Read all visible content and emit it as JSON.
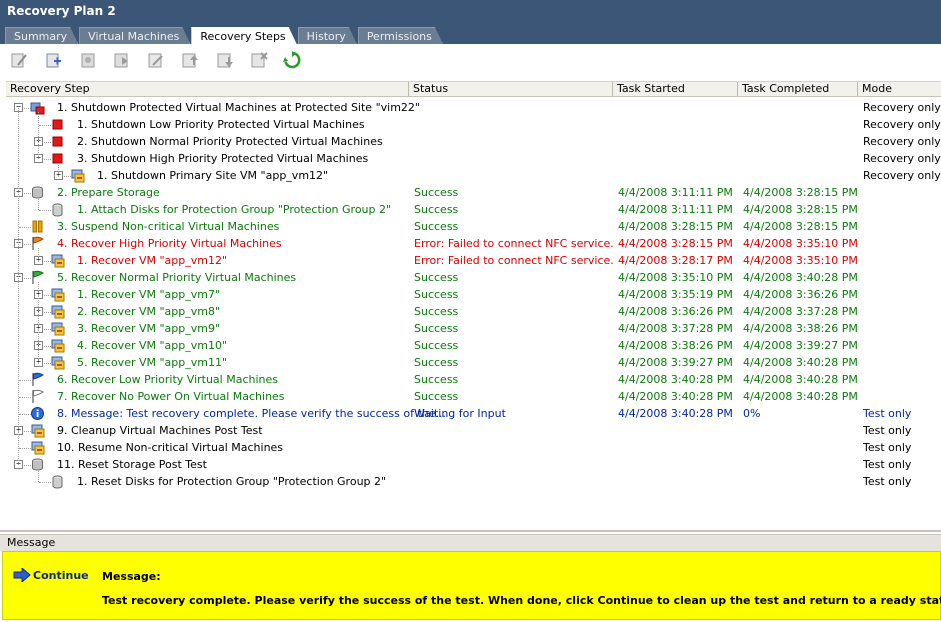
{
  "window": {
    "title": "Recovery Plan 2"
  },
  "tabs": [
    {
      "label": "Summary",
      "active": false
    },
    {
      "label": "Virtual Machines",
      "active": false
    },
    {
      "label": "Recovery Steps",
      "active": true
    },
    {
      "label": "History",
      "active": false
    },
    {
      "label": "Permissions",
      "active": false
    }
  ],
  "toolbar": {
    "buttons": [
      "edit-step-icon",
      "add-step-icon",
      "properties-icon",
      "run-icon",
      "edit-icon",
      "move-up-icon",
      "move-down-icon",
      "delete-icon",
      "refresh-icon"
    ]
  },
  "columns": {
    "step": "Recovery Step",
    "status": "Status",
    "started": "Task Started",
    "completed": "Task Completed",
    "mode": "Mode"
  },
  "rows": [
    {
      "level": 0,
      "expander": "-",
      "icon": "shutdown-vm-icon",
      "label": "1. Shutdown Protected Virtual Machines at Protected Site \"vim22\"",
      "color": "black",
      "status": "",
      "started": "",
      "completed": "",
      "mode": "Recovery only"
    },
    {
      "level": 1,
      "expander": "",
      "icon": "priority-red-icon",
      "label": "1. Shutdown Low Priority Protected Virtual Machines",
      "color": "black",
      "status": "",
      "started": "",
      "completed": "",
      "mode": "Recovery only"
    },
    {
      "level": 1,
      "expander": "+",
      "icon": "priority-red-icon",
      "label": "2. Shutdown Normal Priority Protected Virtual Machines",
      "color": "black",
      "status": "",
      "started": "",
      "completed": "",
      "mode": "Recovery only"
    },
    {
      "level": 1,
      "expander": "-",
      "icon": "priority-red-icon",
      "label": "3. Shutdown High Priority Protected Virtual Machines",
      "color": "black",
      "status": "",
      "started": "",
      "completed": "",
      "mode": "Recovery only"
    },
    {
      "level": 2,
      "expander": "+",
      "icon": "vm-icon",
      "label": "1. Shutdown Primary Site VM \"app_vm12\"",
      "color": "black",
      "status": "",
      "started": "",
      "completed": "",
      "mode": "Recovery only"
    },
    {
      "level": 0,
      "expander": "-",
      "icon": "storage-icon",
      "label": "2. Prepare Storage",
      "color": "green",
      "status": "Success",
      "started": "4/4/2008 3:11:11 PM",
      "completed": "4/4/2008 3:28:15 PM",
      "mode": ""
    },
    {
      "level": 1,
      "expander": "",
      "icon": "disk-icon",
      "label": "1. Attach Disks for Protection Group \"Protection Group 2\"",
      "color": "green",
      "status": "Success",
      "started": "4/4/2008 3:11:11 PM",
      "completed": "4/4/2008 3:28:15 PM",
      "mode": ""
    },
    {
      "level": 0,
      "expander": "",
      "icon": "pause-icon",
      "label": "3. Suspend Non-critical Virtual Machines",
      "color": "green",
      "status": "Success",
      "started": "4/4/2008 3:28:15 PM",
      "completed": "4/4/2008 3:28:15 PM",
      "mode": ""
    },
    {
      "level": 0,
      "expander": "-",
      "icon": "flag-orange-icon",
      "label": "4. Recover High Priority Virtual Machines",
      "color": "red",
      "status": "Error: Failed to connect NFC service.",
      "started": "4/4/2008 3:28:15 PM",
      "completed": "4/4/2008 3:35:10 PM",
      "mode": ""
    },
    {
      "level": 1,
      "expander": "+",
      "icon": "vm-icon",
      "label": "1. Recover VM \"app_vm12\"",
      "color": "red",
      "status": "Error: Failed to connect NFC service.",
      "started": "4/4/2008 3:28:17 PM",
      "completed": "4/4/2008 3:35:10 PM",
      "mode": ""
    },
    {
      "level": 0,
      "expander": "-",
      "icon": "flag-green-icon",
      "label": "5. Recover Normal Priority Virtual Machines",
      "color": "green",
      "status": "Success",
      "started": "4/4/2008 3:35:10 PM",
      "completed": "4/4/2008 3:40:28 PM",
      "mode": ""
    },
    {
      "level": 1,
      "expander": "+",
      "icon": "vm-icon",
      "label": "1. Recover VM \"app_vm7\"",
      "color": "green",
      "status": "Success",
      "started": "4/4/2008 3:35:19 PM",
      "completed": "4/4/2008 3:36:26 PM",
      "mode": ""
    },
    {
      "level": 1,
      "expander": "+",
      "icon": "vm-icon",
      "label": "2. Recover VM \"app_vm8\"",
      "color": "green",
      "status": "Success",
      "started": "4/4/2008 3:36:26 PM",
      "completed": "4/4/2008 3:37:28 PM",
      "mode": ""
    },
    {
      "level": 1,
      "expander": "+",
      "icon": "vm-icon",
      "label": "3. Recover VM \"app_vm9\"",
      "color": "green",
      "status": "Success",
      "started": "4/4/2008 3:37:28 PM",
      "completed": "4/4/2008 3:38:26 PM",
      "mode": ""
    },
    {
      "level": 1,
      "expander": "+",
      "icon": "vm-icon",
      "label": "4. Recover VM \"app_vm10\"",
      "color": "green",
      "status": "Success",
      "started": "4/4/2008 3:38:26 PM",
      "completed": "4/4/2008 3:39:27 PM",
      "mode": ""
    },
    {
      "level": 1,
      "expander": "+",
      "icon": "vm-icon",
      "label": "5. Recover VM \"app_vm11\"",
      "color": "green",
      "status": "Success",
      "started": "4/4/2008 3:39:27 PM",
      "completed": "4/4/2008 3:40:28 PM",
      "mode": ""
    },
    {
      "level": 0,
      "expander": "",
      "icon": "flag-blue-icon",
      "label": "6. Recover Low Priority Virtual Machines",
      "color": "green",
      "status": "Success",
      "started": "4/4/2008 3:40:28 PM",
      "completed": "4/4/2008 3:40:28 PM",
      "mode": ""
    },
    {
      "level": 0,
      "expander": "",
      "icon": "flag-white-icon",
      "label": "7. Recover No Power On Virtual Machines",
      "color": "green",
      "status": "Success",
      "started": "4/4/2008 3:40:28 PM",
      "completed": "4/4/2008 3:40:28 PM",
      "mode": ""
    },
    {
      "level": 0,
      "expander": "",
      "icon": "info-icon",
      "label": "8. Message: Test recovery complete. Please verify the success of the...",
      "color": "blue",
      "status": "Waiting for Input",
      "started": "4/4/2008 3:40:28 PM",
      "completed": "0%",
      "mode": "Test only"
    },
    {
      "level": 0,
      "expander": "+",
      "icon": "vm-icon",
      "label": "9. Cleanup Virtual Machines Post Test",
      "color": "black",
      "status": "",
      "started": "",
      "completed": "",
      "mode": "Test only"
    },
    {
      "level": 0,
      "expander": "",
      "icon": "vm-icon",
      "label": "10. Resume Non-critical Virtual Machines",
      "color": "black",
      "status": "",
      "started": "",
      "completed": "",
      "mode": "Test only"
    },
    {
      "level": 0,
      "expander": "-",
      "icon": "storage-icon",
      "label": "11. Reset Storage Post Test",
      "color": "black",
      "status": "",
      "started": "",
      "completed": "",
      "mode": "Test only"
    },
    {
      "level": 1,
      "expander": "",
      "icon": "disk-icon",
      "label": "1. Reset Disks for Protection Group \"Protection Group 2\"",
      "color": "black",
      "status": "",
      "started": "",
      "completed": "",
      "mode": "Test only"
    }
  ],
  "message_panel": {
    "header": "Message",
    "continue_label": "Continue",
    "title": "Message:",
    "text": "Test recovery complete. Please verify the success of the test. When done, click Continue to clean up the test and return to a ready state."
  },
  "colors": {
    "success": "#0a7a0a",
    "error": "#d40000",
    "waiting": "#0028a0",
    "titlebar": "#3c5677",
    "message_bg": "#ffff00"
  }
}
